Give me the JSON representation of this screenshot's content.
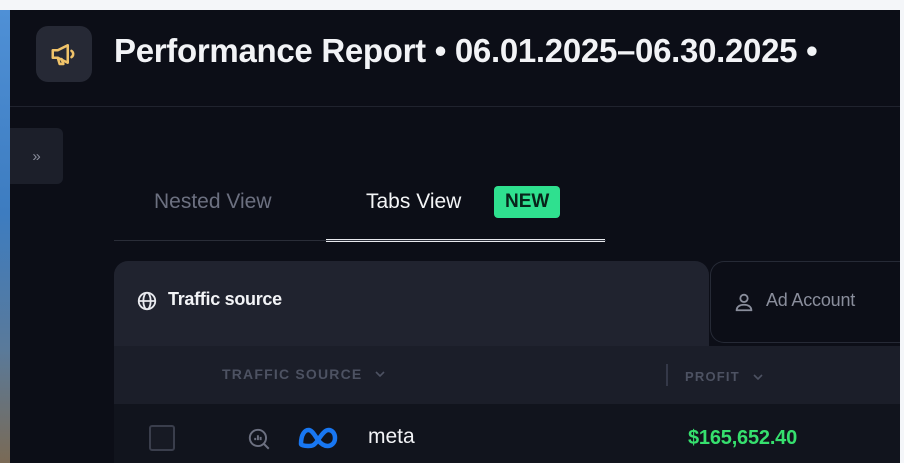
{
  "header": {
    "title": "Performance Report • 06.01.2025–06.30.2025 •",
    "icon": "megaphone-icon"
  },
  "sidebar": {
    "expand_label": "»",
    "expand_icon": "double-chevron-right-icon"
  },
  "view_tabs": {
    "nested_label": "Nested View",
    "tabs_label": "Tabs View",
    "tabs_badge": "NEW",
    "active": "Tabs View"
  },
  "group_tabs": [
    {
      "label": "Traffic source",
      "icon": "globe-icon",
      "active": true
    },
    {
      "label": "Ad Account",
      "icon": "user-icon",
      "active": false
    }
  ],
  "table": {
    "columns": [
      "TRAFFIC SOURCE",
      "PROFIT"
    ],
    "rows": [
      {
        "source": "meta",
        "profit": "$165,652.40",
        "source_icon": "meta-logo-icon"
      }
    ]
  },
  "colors": {
    "accent_badge": "#2fe08f",
    "profit_positive": "#36e06e",
    "meta_blue": "#1877f2",
    "app_background": "#0c0e17"
  }
}
